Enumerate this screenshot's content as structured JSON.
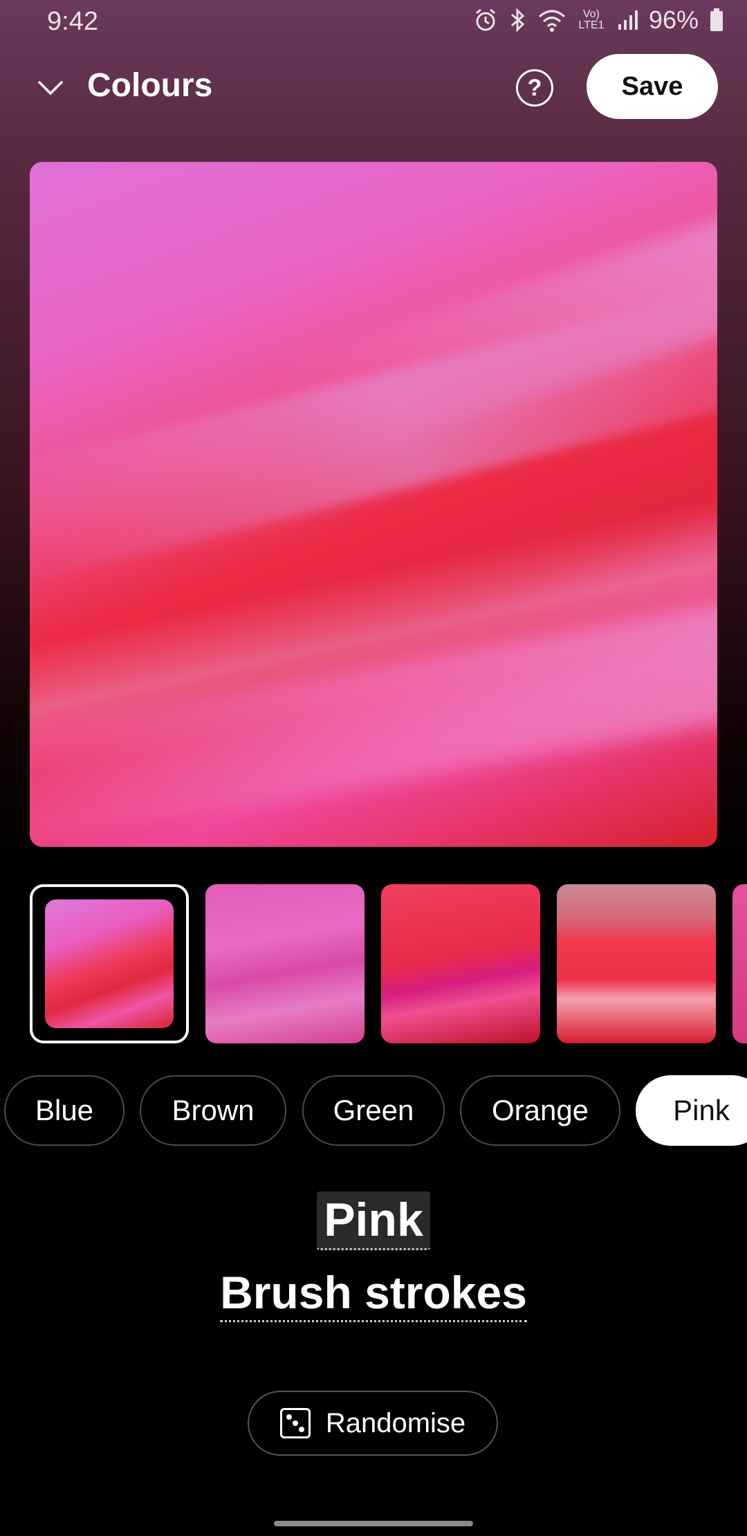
{
  "status_bar": {
    "time": "9:42",
    "network_label": "Vo) LTE1",
    "battery": "96%",
    "icons": [
      "alarm-icon",
      "bluetooth-icon",
      "wifi-icon",
      "signal-icon",
      "battery-icon"
    ]
  },
  "header": {
    "title": "Colours",
    "help_symbol": "?",
    "save_label": "Save"
  },
  "thumbnails": [
    {
      "name": "pink-brush-strokes-1",
      "selected": true
    },
    {
      "name": "pink-brush-strokes-2",
      "selected": false
    },
    {
      "name": "pink-brush-strokes-3",
      "selected": false
    },
    {
      "name": "pink-brush-strokes-4",
      "selected": false
    },
    {
      "name": "pink-brush-strokes-5",
      "selected": false
    }
  ],
  "categories": [
    {
      "label": "Blue",
      "active": false
    },
    {
      "label": "Brown",
      "active": false
    },
    {
      "label": "Green",
      "active": false
    },
    {
      "label": "Orange",
      "active": false
    },
    {
      "label": "Pink",
      "active": true
    }
  ],
  "selection": {
    "category": "Pink",
    "name": "Brush strokes"
  },
  "randomise_label": "Randomise",
  "colors": {
    "accent": "#ffffff",
    "background_top": "#6b3a5c",
    "background_bottom": "#000000"
  }
}
